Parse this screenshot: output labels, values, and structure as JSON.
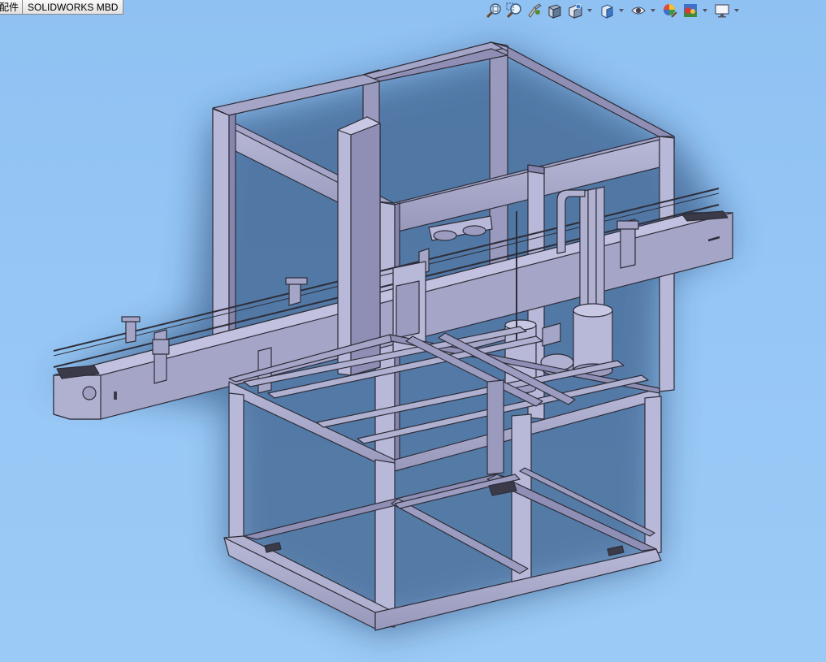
{
  "tabs": [
    {
      "label": "配件",
      "state": "partially-visible"
    },
    {
      "label": "SOLIDWORKS MBD",
      "state": "normal"
    }
  ],
  "heads_up_toolbar": {
    "buttons": [
      {
        "name": "zoom-to-fit",
        "icon": "zoom-fit-icon"
      },
      {
        "name": "zoom-to-area",
        "icon": "zoom-area-icon"
      },
      {
        "name": "previous-view",
        "icon": "previous-view-icon"
      },
      {
        "name": "section-view",
        "icon": "section-view-icon"
      },
      {
        "name": "dynamic-annotation-views",
        "icon": "annotation-view-icon"
      },
      {
        "name": "view-orientation",
        "icon": "view-orientation-icon",
        "has_dropdown": true
      },
      {
        "name": "display-style",
        "icon": "display-style-icon",
        "has_dropdown": true
      },
      {
        "name": "hide-show-items",
        "icon": "hide-show-icon",
        "has_dropdown": true
      },
      {
        "name": "edit-appearance",
        "icon": "edit-appearance-icon"
      },
      {
        "name": "apply-scene",
        "icon": "apply-scene-icon",
        "has_dropdown": true
      },
      {
        "name": "view-settings",
        "icon": "view-settings-icon",
        "has_dropdown": true
      }
    ]
  },
  "viewport": {
    "background_top": "#8fc1f2",
    "background_bottom": "#9ccaf6",
    "model_color": "#a5a5c8",
    "edge_color": "#2e2e3a"
  }
}
